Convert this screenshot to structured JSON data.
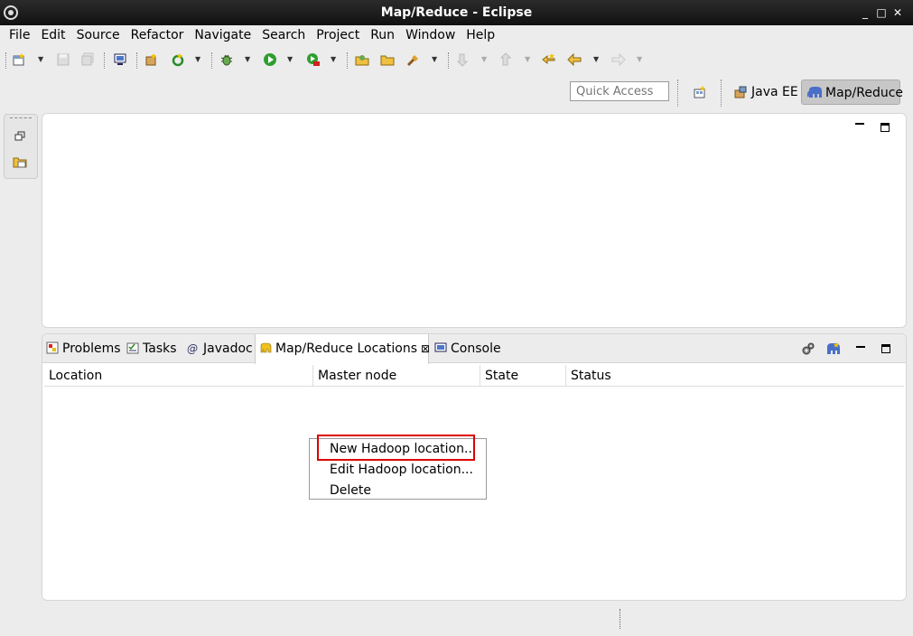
{
  "window": {
    "title": "Map/Reduce - Eclipse"
  },
  "menu": [
    "File",
    "Edit",
    "Source",
    "Refactor",
    "Navigate",
    "Search",
    "Project",
    "Run",
    "Window",
    "Help"
  ],
  "perspective_bar": {
    "quick_access_placeholder": "Quick Access",
    "perspectives": [
      "Java EE",
      "Map/Reduce"
    ]
  },
  "view_tabs": {
    "problems": "Problems",
    "tasks": "Tasks",
    "javadoc": "Javadoc",
    "mapreduce_locations": "Map/Reduce Locations",
    "console": "Console",
    "javadoc_glyph": "@",
    "close_glyph": "⊠"
  },
  "locations_table": {
    "columns": [
      "Location",
      "Master node",
      "State",
      "Status"
    ]
  },
  "context_menu": {
    "items": [
      "New Hadoop location...",
      "Edit Hadoop location...",
      "Delete"
    ],
    "highlighted_index": 0
  },
  "colors": {
    "highlight": "#dd0000",
    "active_perspective": "#c7c7c7"
  }
}
